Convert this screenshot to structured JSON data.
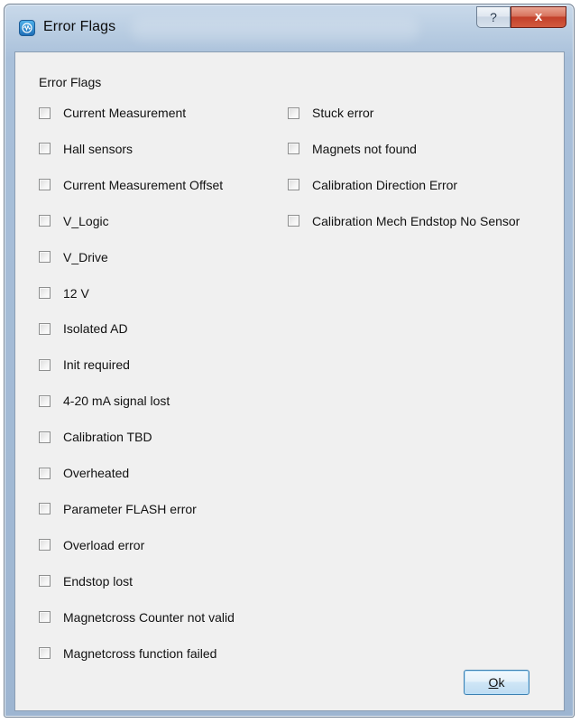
{
  "window": {
    "title": "Error Flags",
    "help_glyph": "?",
    "close_glyph": "x"
  },
  "group": {
    "title": "Error Flags"
  },
  "flags_left": [
    {
      "label": "Current Measurement",
      "checked": false
    },
    {
      "label": "Hall sensors",
      "checked": false
    },
    {
      "label": "Current Measurement Offset",
      "checked": false
    },
    {
      "label": "V_Logic",
      "checked": false
    },
    {
      "label": "V_Drive",
      "checked": false
    },
    {
      "label": "12 V",
      "checked": false
    },
    {
      "label": "Isolated AD",
      "checked": false
    },
    {
      "label": "Init required",
      "checked": false
    },
    {
      "label": "4-20 mA signal lost",
      "checked": false
    },
    {
      "label": "Calibration TBD",
      "checked": false
    },
    {
      "label": "Overheated",
      "checked": false
    },
    {
      "label": "Parameter FLASH error",
      "checked": false
    },
    {
      "label": "Overload error",
      "checked": false
    },
    {
      "label": "Endstop lost",
      "checked": false
    },
    {
      "label": "Magnetcross Counter not valid",
      "checked": false
    },
    {
      "label": "Magnetcross function failed",
      "checked": false
    }
  ],
  "flags_right": [
    {
      "label": "Stuck error",
      "checked": false
    },
    {
      "label": "Magnets not found",
      "checked": false
    },
    {
      "label": "Calibration Direction Error",
      "checked": false
    },
    {
      "label": "Calibration Mech Endstop No Sensor",
      "checked": false
    }
  ],
  "ok_button": {
    "mnemonic": "O",
    "rest": "k"
  }
}
